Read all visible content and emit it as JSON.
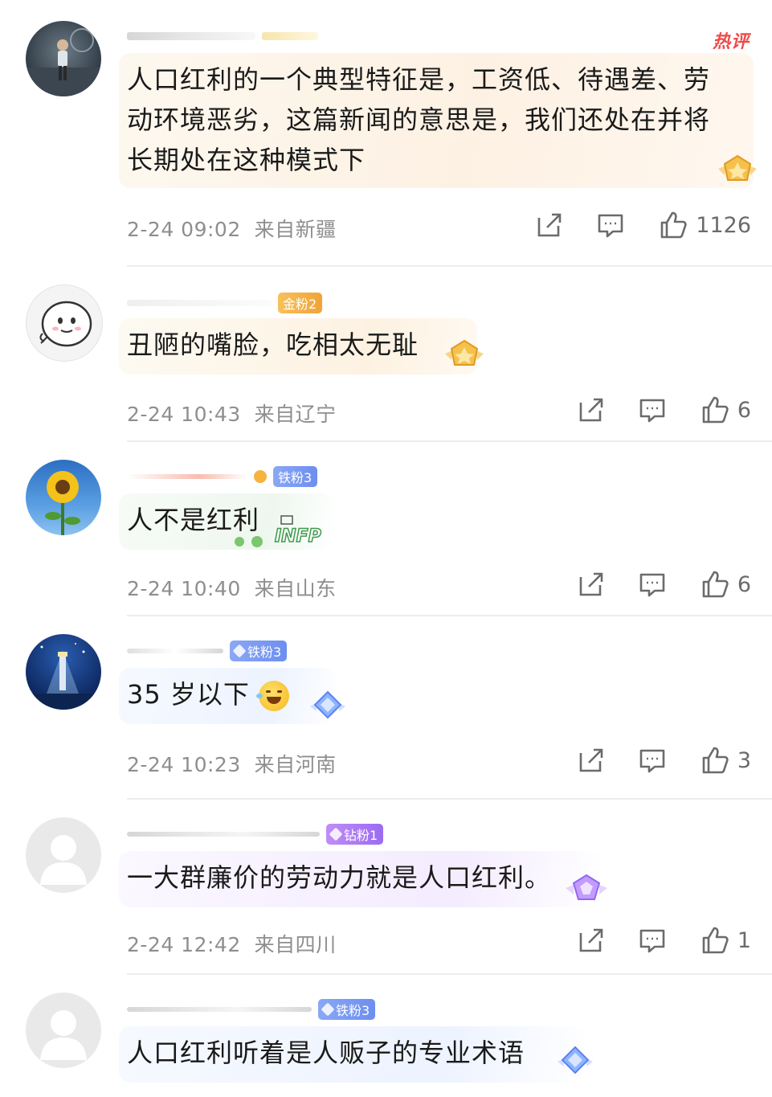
{
  "comments": [
    {
      "hot_label": "热评",
      "text_line1": "人口红利的一个典型特征是，工资低、待遇差、劳",
      "text_line2": "动环境恶劣，这篇新闻的意思是，我们还处在并将",
      "text_line3": "长期处在这种模式下",
      "time": "2-24 09:02",
      "location": "来自新疆",
      "likes": "1126"
    },
    {
      "badge": "金粉2",
      "text": "丑陋的嘴脸，吃相太无耻",
      "time": "2-24 10:43",
      "location": "来自辽宁",
      "likes": "6"
    },
    {
      "badge": "铁粉3",
      "text": "人不是红利",
      "decor_label": "INFP",
      "time": "2-24 10:40",
      "location": "来自山东",
      "likes": "6"
    },
    {
      "badge": "铁粉3",
      "text": "35 岁以下",
      "time": "2-24 10:23",
      "location": "来自河南",
      "likes": "3"
    },
    {
      "badge": "钻粉1",
      "text": "一大群廉价的劳动力就是人口红利。",
      "time": "2-24 12:42",
      "location": "来自四川",
      "likes": "1"
    },
    {
      "badge": "铁粉3",
      "text": "人口红利听着是人贩子的专业术语"
    }
  ],
  "icons": {
    "share": "share-icon",
    "comment": "comment-icon",
    "like": "thumbs-up-icon"
  },
  "colors": {
    "meta_gray": "#8e8e8e",
    "hot_red": "#f04a4a",
    "gold_badge": "#f0a338",
    "iron_badge": "#6d8ef0",
    "diamond_badge": "#9b6cf2"
  }
}
